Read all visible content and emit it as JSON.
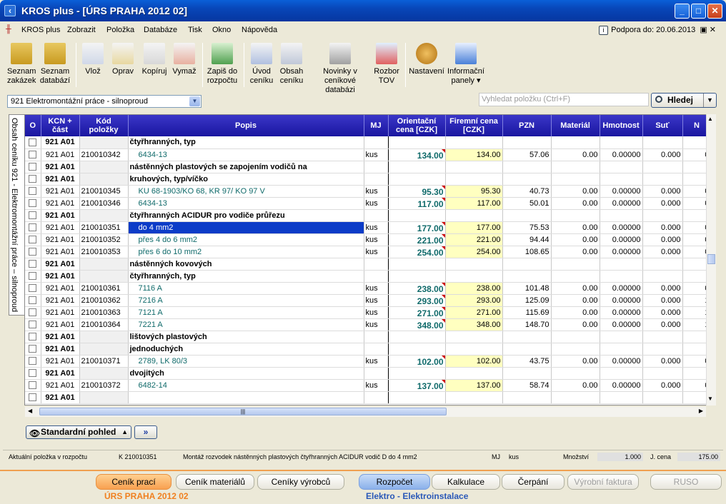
{
  "window": {
    "title": "KROS plus - [ÚRS PRAHA 2012 02]"
  },
  "menu": {
    "items": [
      "KROS plus",
      "Zobrazit",
      "Položka",
      "Databáze",
      "Tisk",
      "Okno",
      "Nápověda"
    ],
    "support": "Podpora do: 20.06.2013"
  },
  "toolbar": {
    "buttons": [
      {
        "label1": "Seznam",
        "label2": "zakázek"
      },
      {
        "label1": "Seznam",
        "label2": "databází"
      },
      {
        "label1": "Vlož",
        "label2": ""
      },
      {
        "label1": "Oprav",
        "label2": ""
      },
      {
        "label1": "Kopíruj",
        "label2": ""
      },
      {
        "label1": "Vymaž",
        "label2": ""
      },
      {
        "label1": "Zapiš do",
        "label2": "rozpočtu"
      },
      {
        "label1": "Úvod",
        "label2": "ceníku"
      },
      {
        "label1": "Obsah",
        "label2": "ceníku"
      },
      {
        "label1": "Novinky v",
        "label2": "ceníkové databázi"
      },
      {
        "label1": "Rozbor",
        "label2": "TOV"
      },
      {
        "label1": "Nastavení",
        "label2": ""
      },
      {
        "label1": "Informační",
        "label2": "panely ▾"
      }
    ]
  },
  "filter": {
    "combo": "921  Elektromontážní práce - silnoproud",
    "search_placeholder": "Vyhledat položku (Ctrl+F)",
    "search_button": "Hledej"
  },
  "sidetab": "Obsah ceníku 921 - Elektromontážní práce – silnoproud",
  "columns": {
    "o": "O",
    "kcn1": "KCN +",
    "kcn2": "část",
    "kod1": "Kód",
    "kod2": "položky",
    "popis": "Popis",
    "mj": "MJ",
    "oc1": "Orientační",
    "oc2": "cena [CZK]",
    "fc1": "Firemní cena",
    "fc2": "[CZK]",
    "pzn": "PZN",
    "mat": "Materiál",
    "hm": "Hmotnost",
    "sut": "Suť",
    "n": "N"
  },
  "rows": [
    {
      "kcn": "921 A01",
      "kod": "",
      "popis": "čtyřhranných, typ",
      "mj": "",
      "oc": "",
      "fc": "",
      "pzn": "",
      "mat": "",
      "hm": "",
      "sut": "",
      "n": ""
    },
    {
      "kcn": "921 A01",
      "kod": "210010342",
      "popis": "6434-13",
      "mj": "kus",
      "oc": "134.00",
      "fc": "134.00",
      "pzn": "57.06",
      "mat": "0.00",
      "hm": "0.00000",
      "sut": "0.000",
      "n": "0"
    },
    {
      "kcn": "921 A01",
      "kod": "",
      "popis": "nástěnných plastových se zapojením vodičů na",
      "mj": "",
      "oc": "",
      "fc": "",
      "pzn": "",
      "mat": "",
      "hm": "",
      "sut": "",
      "n": ""
    },
    {
      "kcn": "921 A01",
      "kod": "",
      "popis": "kruhových, typ/víčko",
      "mj": "",
      "oc": "",
      "fc": "",
      "pzn": "",
      "mat": "",
      "hm": "",
      "sut": "",
      "n": ""
    },
    {
      "kcn": "921 A01",
      "kod": "210010345",
      "popis": "KU 68-1903/KO 68, KR 97/ KO 97 V",
      "mj": "kus",
      "oc": "95.30",
      "fc": "95.30",
      "pzn": "40.73",
      "mat": "0.00",
      "hm": "0.00000",
      "sut": "0.000",
      "n": "0"
    },
    {
      "kcn": "921 A01",
      "kod": "210010346",
      "popis": "6434-13",
      "mj": "kus",
      "oc": "117.00",
      "fc": "117.00",
      "pzn": "50.01",
      "mat": "0.00",
      "hm": "0.00000",
      "sut": "0.000",
      "n": "0"
    },
    {
      "kcn": "921 A01",
      "kod": "",
      "popis": "čtyřhranných ACIDUR pro vodiče průřezu",
      "mj": "",
      "oc": "",
      "fc": "",
      "pzn": "",
      "mat": "",
      "hm": "",
      "sut": "",
      "n": ""
    },
    {
      "kcn": "921 A01",
      "kod": "210010351",
      "popis": "do 4 mm2",
      "mj": "kus",
      "oc": "177.00",
      "fc": "177.00",
      "pzn": "75.53",
      "mat": "0.00",
      "hm": "0.00000",
      "sut": "0.000",
      "n": "0"
    },
    {
      "kcn": "921 A01",
      "kod": "210010352",
      "popis": "přes 4 do 6 mm2",
      "mj": "kus",
      "oc": "221.00",
      "fc": "221.00",
      "pzn": "94.44",
      "mat": "0.00",
      "hm": "0.00000",
      "sut": "0.000",
      "n": "0"
    },
    {
      "kcn": "921 A01",
      "kod": "210010353",
      "popis": "přes 6 do 10 mm2",
      "mj": "kus",
      "oc": "254.00",
      "fc": "254.00",
      "pzn": "108.65",
      "mat": "0.00",
      "hm": "0.00000",
      "sut": "0.000",
      "n": "0"
    },
    {
      "kcn": "921 A01",
      "kod": "",
      "popis": "nástěnných kovových",
      "mj": "",
      "oc": "",
      "fc": "",
      "pzn": "",
      "mat": "",
      "hm": "",
      "sut": "",
      "n": ""
    },
    {
      "kcn": "921 A01",
      "kod": "",
      "popis": "čtyřhranných, typ",
      "mj": "",
      "oc": "",
      "fc": "",
      "pzn": "",
      "mat": "",
      "hm": "",
      "sut": "",
      "n": ""
    },
    {
      "kcn": "921 A01",
      "kod": "210010361",
      "popis": "7116 A",
      "mj": "kus",
      "oc": "238.00",
      "fc": "238.00",
      "pzn": "101.48",
      "mat": "0.00",
      "hm": "0.00000",
      "sut": "0.000",
      "n": "0"
    },
    {
      "kcn": "921 A01",
      "kod": "210010362",
      "popis": "7216 A",
      "mj": "kus",
      "oc": "293.00",
      "fc": "293.00",
      "pzn": "125.09",
      "mat": "0.00",
      "hm": "0.00000",
      "sut": "0.000",
      "n": "1"
    },
    {
      "kcn": "921 A01",
      "kod": "210010363",
      "popis": "7121 A",
      "mj": "kus",
      "oc": "271.00",
      "fc": "271.00",
      "pzn": "115.69",
      "mat": "0.00",
      "hm": "0.00000",
      "sut": "0.000",
      "n": "1"
    },
    {
      "kcn": "921 A01",
      "kod": "210010364",
      "popis": "7221 A",
      "mj": "kus",
      "oc": "348.00",
      "fc": "348.00",
      "pzn": "148.70",
      "mat": "0.00",
      "hm": "0.00000",
      "sut": "0.000",
      "n": "1"
    },
    {
      "kcn": "921 A01",
      "kod": "",
      "popis": "lištových plastových",
      "mj": "",
      "oc": "",
      "fc": "",
      "pzn": "",
      "mat": "",
      "hm": "",
      "sut": "",
      "n": ""
    },
    {
      "kcn": "921 A01",
      "kod": "",
      "popis": "jednoduchých",
      "mj": "",
      "oc": "",
      "fc": "",
      "pzn": "",
      "mat": "",
      "hm": "",
      "sut": "",
      "n": ""
    },
    {
      "kcn": "921 A01",
      "kod": "210010371",
      "popis": "2789, LK 80/3",
      "mj": "kus",
      "oc": "102.00",
      "fc": "102.00",
      "pzn": "43.75",
      "mat": "0.00",
      "hm": "0.00000",
      "sut": "0.000",
      "n": "0"
    },
    {
      "kcn": "921 A01",
      "kod": "",
      "popis": "dvojitých",
      "mj": "",
      "oc": "",
      "fc": "",
      "pzn": "",
      "mat": "",
      "hm": "",
      "sut": "",
      "n": ""
    },
    {
      "kcn": "921 A01",
      "kod": "210010372",
      "popis": "6482-14",
      "mj": "kus",
      "oc": "137.00",
      "fc": "137.00",
      "pzn": "58.74",
      "mat": "0.00",
      "hm": "0.00000",
      "sut": "0.000",
      "n": "0"
    },
    {
      "kcn": "921 A01",
      "kod": "",
      "popis": "",
      "mj": "",
      "oc": "",
      "fc": "",
      "pzn": "",
      "mat": "",
      "hm": "",
      "sut": "",
      "n": ""
    }
  ],
  "selected_row": 7,
  "view": {
    "button": "Standardní pohled"
  },
  "status": {
    "label": "Aktuální položka v rozpočtu",
    "kod": "K  210010351",
    "popis": "Montáž rozvodek nástěnných plastových čtyřhranných ACIDUR vodič D do 4 mm2",
    "mj_label": "MJ",
    "mj": "kus",
    "mn_label": "Množství",
    "mn": "1.000",
    "jc_label": "J. cena",
    "jc": "175.00"
  },
  "bottom": {
    "tabs": [
      "Ceník prací",
      "Ceník materiálů",
      "Ceníky výrobců",
      "Rozpočet",
      "Kalkulace",
      "Čerpání",
      "Výrobní faktura",
      "RUSO"
    ],
    "left_label": "ÚRS PRAHA 2012 02",
    "right_label": "Elektro - Elektroinstalace"
  },
  "colors": {
    "accent": "#f8a050",
    "header": "#1a16a0",
    "teal_text": "#0f6a6a"
  }
}
